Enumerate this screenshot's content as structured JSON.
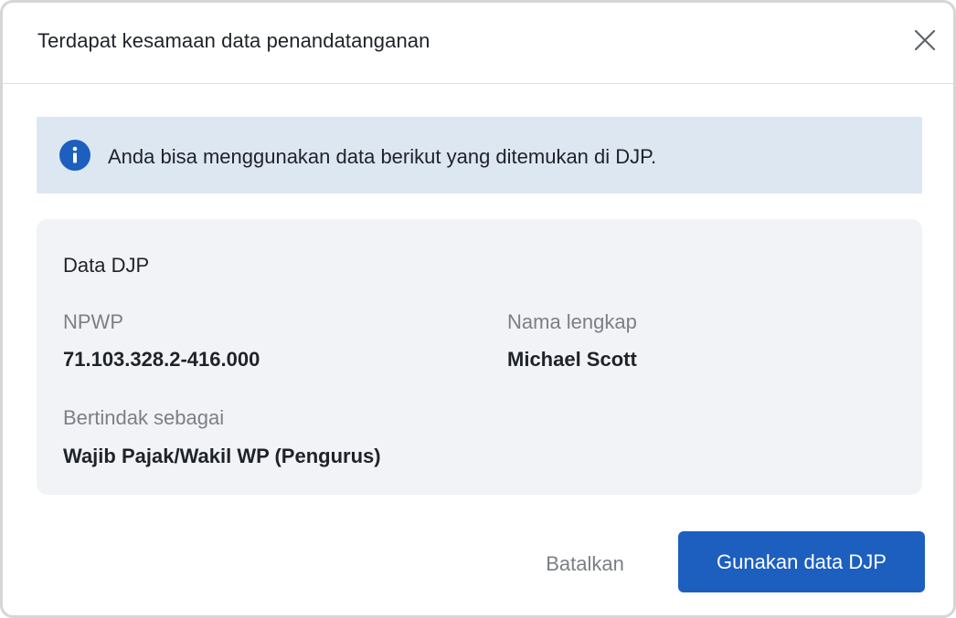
{
  "dialog": {
    "title": "Terdapat kesamaan data penandatanganan",
    "close_icon": "close-icon"
  },
  "info": {
    "icon": "info-icon",
    "text": "Anda bisa menggunakan data berikut yang ditemukan di DJP.",
    "background": "#dde7f2",
    "icon_color": "#1d5fbf"
  },
  "card": {
    "title": "Data DJP",
    "fields": {
      "npwp": {
        "label": "NPWP",
        "value": "71.103.328.2-416.000"
      },
      "nama": {
        "label": "Nama lengkap",
        "value": "Michael Scott"
      },
      "bertindak": {
        "label": "Bertindak sebagai",
        "value": "Wajib Pajak/Wakil WP (Pengurus)"
      }
    }
  },
  "actions": {
    "cancel_label": "Batalkan",
    "primary_label": "Gunakan data DJP",
    "primary_color": "#1d5fbf"
  }
}
